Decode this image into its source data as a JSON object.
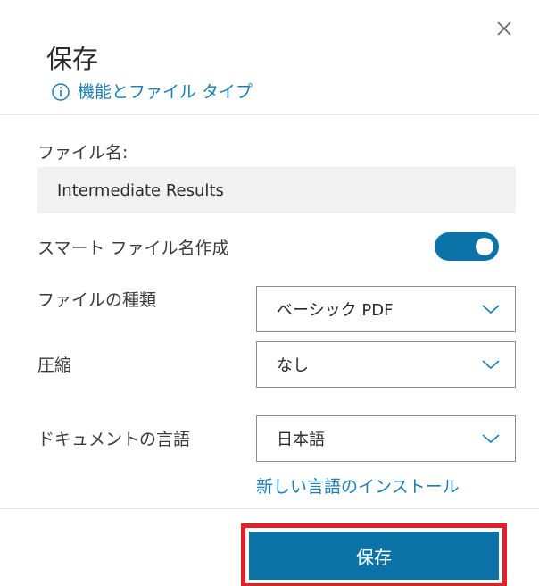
{
  "dialog": {
    "title": "保存",
    "info_link": "機能とファイル タイプ"
  },
  "filename": {
    "label": "ファイル名:",
    "value": "Intermediate Results"
  },
  "smart_filename": {
    "label": "スマート ファイル名作成",
    "enabled": true
  },
  "file_type": {
    "label": "ファイルの種類",
    "selected": "ベーシック PDF"
  },
  "compression": {
    "label": "圧縮",
    "selected": "なし"
  },
  "document_language": {
    "label": "ドキュメントの言語",
    "selected": "日本語"
  },
  "install_language_link": "新しい言語のインストール",
  "save_button": "保存",
  "colors": {
    "accent": "#0b73a8",
    "link": "#1a7fb5",
    "highlight_border": "#e3202a"
  },
  "icons": [
    "close-icon",
    "info-icon",
    "chevron-down-icon"
  ]
}
